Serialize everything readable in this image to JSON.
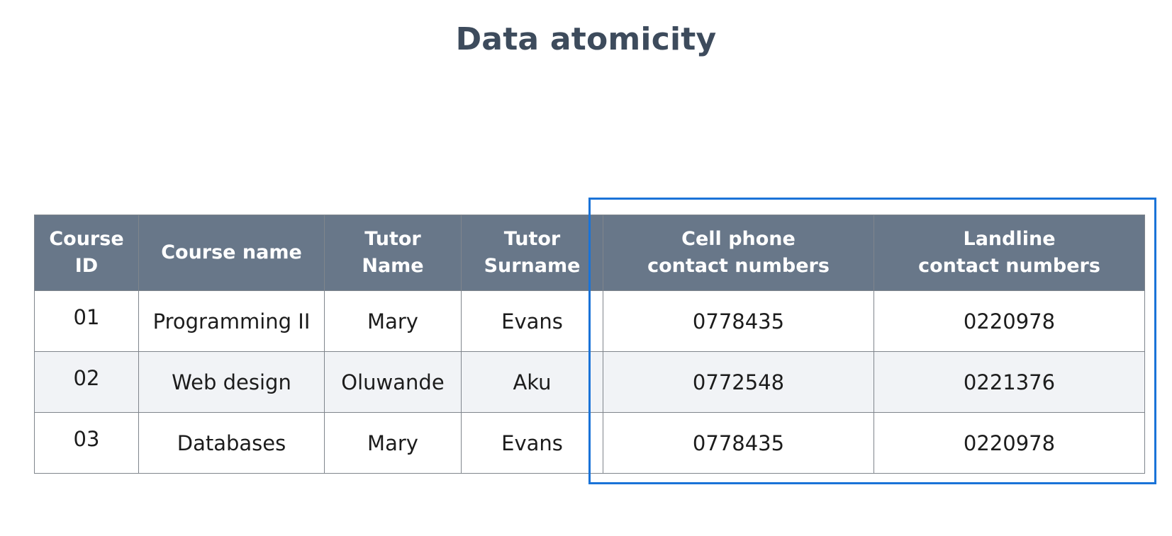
{
  "title": "Data atomicity",
  "table": {
    "headers": [
      {
        "line1": "Course",
        "line2": "ID"
      },
      {
        "line1": "Course name",
        "line2": ""
      },
      {
        "line1": "Tutor",
        "line2": "Name"
      },
      {
        "line1": "Tutor",
        "line2": "Surname"
      },
      {
        "line1": "Cell phone",
        "line2": "contact numbers"
      },
      {
        "line1": "Landline",
        "line2": "contact numbers"
      }
    ],
    "rows": [
      [
        "01",
        "Programming II",
        "Mary",
        "Evans",
        "0778435",
        "0220978"
      ],
      [
        "02",
        "Web design",
        "Oluwande",
        "Aku",
        "0772548",
        "0221376"
      ],
      [
        "03",
        "Databases",
        "Mary",
        "Evans",
        "0778435",
        "0220978"
      ]
    ]
  },
  "colors": {
    "header_bg": "#687789",
    "title": "#3d4b5c",
    "highlight": "#1a73d8",
    "alt_row": "#f1f3f6"
  }
}
